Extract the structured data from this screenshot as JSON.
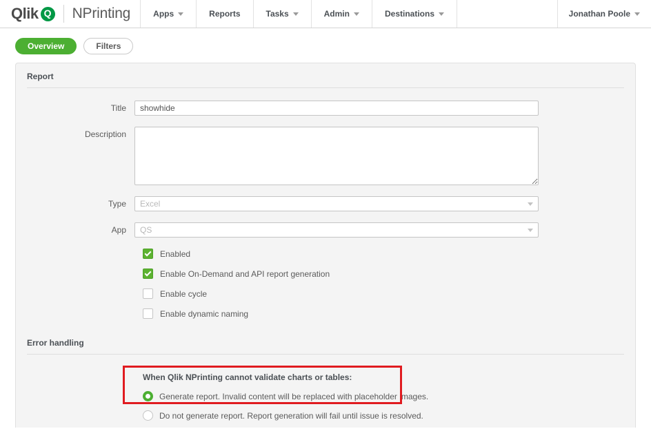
{
  "header": {
    "brand_name": "Qlik",
    "brand_mark": "Q",
    "product_name": "NPrinting",
    "nav": [
      {
        "label": "Apps",
        "has_caret": true
      },
      {
        "label": "Reports",
        "has_caret": false
      },
      {
        "label": "Tasks",
        "has_caret": true
      },
      {
        "label": "Admin",
        "has_caret": true
      },
      {
        "label": "Destinations",
        "has_caret": true
      }
    ],
    "user": "Jonathan Poole"
  },
  "tabs": [
    {
      "label": "Overview",
      "active": true
    },
    {
      "label": "Filters",
      "active": false
    }
  ],
  "report_section": {
    "title": "Report",
    "fields": {
      "title_label": "Title",
      "title_value": "showhide",
      "description_label": "Description",
      "description_value": "",
      "type_label": "Type",
      "type_value": "Excel",
      "app_label": "App",
      "app_value": "QS"
    },
    "checkboxes": [
      {
        "label": "Enabled",
        "checked": true
      },
      {
        "label": "Enable On-Demand and API report generation",
        "checked": true
      },
      {
        "label": "Enable cycle",
        "checked": false
      },
      {
        "label": "Enable dynamic naming",
        "checked": false
      }
    ]
  },
  "error_handling": {
    "title": "Error handling",
    "prompt": "When Qlik NPrinting cannot validate charts or tables:",
    "options": [
      {
        "label": "Generate report. Invalid content will be replaced with placeholder images.",
        "selected": true
      },
      {
        "label": "Do not generate report. Report generation will fail until issue is resolved.",
        "selected": false
      }
    ],
    "highlight_color": "#e01b20"
  },
  "colors": {
    "brand_green": "#009845",
    "accent_green": "#4caf32",
    "panel_bg": "#f4f4f4",
    "text": "#5a5a5a"
  }
}
